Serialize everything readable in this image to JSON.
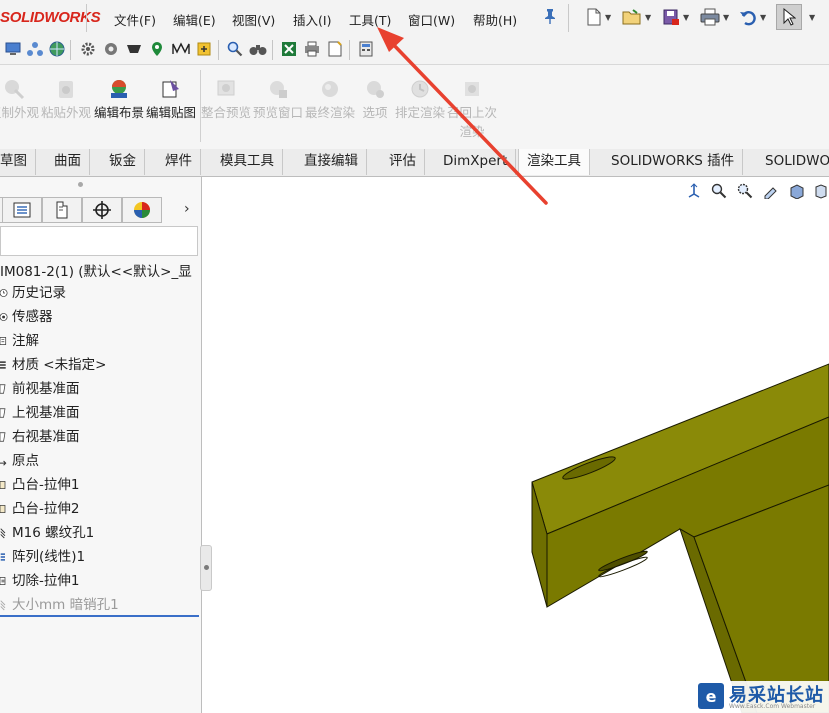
{
  "app": {
    "logo_text": "SOLIDWORKS",
    "brand_color": "#d8261c"
  },
  "menu": {
    "items": [
      "文件(F)",
      "编辑(E)",
      "视图(V)",
      "插入(I)",
      "工具(T)",
      "窗口(W)",
      "帮助(H)"
    ]
  },
  "command_manager": {
    "buttons": [
      {
        "label": "复制外观",
        "enabled": false
      },
      {
        "label": "粘贴外观",
        "enabled": false
      },
      {
        "label": "编辑布景",
        "enabled": true
      },
      {
        "label": "编辑贴图",
        "enabled": true
      },
      {
        "label": "整合预览",
        "enabled": false
      },
      {
        "label": "预览窗口",
        "enabled": false
      },
      {
        "label": "最终渲染",
        "enabled": false
      },
      {
        "label": "选项",
        "enabled": false
      },
      {
        "label": "排定渲染",
        "enabled": false
      },
      {
        "label": "召回上次渲染",
        "enabled": false
      }
    ]
  },
  "tabs": {
    "items": [
      "草图",
      "曲面",
      "钣金",
      "焊件",
      "模具工具",
      "直接编辑",
      "评估",
      "DimXpert",
      "渲染工具",
      "SOLIDWORKS 插件",
      "SOLIDWO"
    ],
    "active": "渲染工具"
  },
  "feature_tree": {
    "part_name": "IM081-2(1)  (默认<<默认>_显",
    "items": [
      {
        "label": "历史记录",
        "icon": "history-icon"
      },
      {
        "label": "传感器",
        "icon": "sensor-icon"
      },
      {
        "label": "注解",
        "icon": "annotation-icon"
      },
      {
        "label": "材质 <未指定>",
        "icon": "material-icon"
      },
      {
        "label": "前视基准面",
        "icon": "plane-icon"
      },
      {
        "label": "上视基准面",
        "icon": "plane-icon"
      },
      {
        "label": "右视基准面",
        "icon": "plane-icon"
      },
      {
        "label": "原点",
        "icon": "origin-icon"
      },
      {
        "label": "凸台-拉伸1",
        "icon": "extrude-icon"
      },
      {
        "label": "凸台-拉伸2",
        "icon": "extrude-icon"
      },
      {
        "label": "M16 螺纹孔1",
        "icon": "hole-icon"
      },
      {
        "label": "阵列(线性)1",
        "icon": "pattern-icon"
      },
      {
        "label": "切除-拉伸1",
        "icon": "cut-icon"
      },
      {
        "label": "大小mm 暗销孔1",
        "icon": "hole-icon",
        "suppressed": true
      }
    ]
  },
  "watermark": {
    "logo_char": "e",
    "title": "易采站长站",
    "subtitle": "Www.Easck.Com  Webmaster"
  },
  "colors": {
    "model_face": "#7a7a00",
    "model_top": "#8a8a08",
    "annotation_arrow": "#e8412f"
  }
}
